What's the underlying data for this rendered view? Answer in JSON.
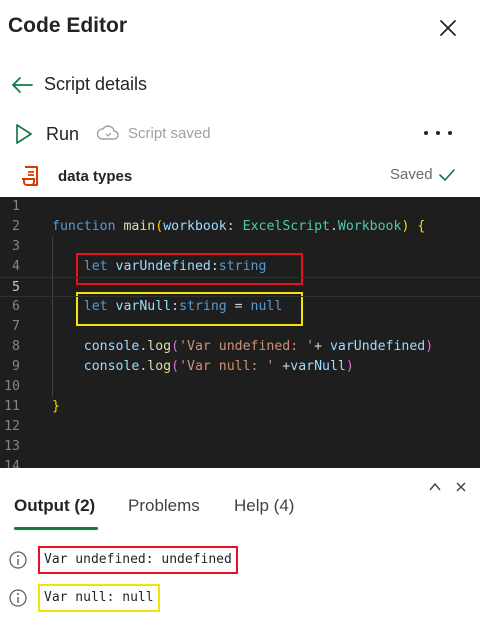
{
  "header": {
    "title": "Code Editor"
  },
  "nav": {
    "back_label": "Script details"
  },
  "toolbar": {
    "run_label": "Run",
    "status_label": "Script saved"
  },
  "file": {
    "name": "data types",
    "save_state": "Saved"
  },
  "editor": {
    "line_numbers": [
      "1",
      "2",
      "3",
      "4",
      "5",
      "6",
      "7",
      "8",
      "9",
      "10",
      "11",
      "12",
      "13",
      "14"
    ],
    "active_line": "5",
    "lines": [
      [],
      [
        {
          "t": "function",
          "c": "kw"
        },
        {
          "t": " "
        },
        {
          "t": "main",
          "c": "fn"
        },
        {
          "t": "(",
          "c": "p1"
        },
        {
          "t": "workbook",
          "c": "var"
        },
        {
          "t": ": "
        },
        {
          "t": "ExcelScript",
          "c": "type"
        },
        {
          "t": "."
        },
        {
          "t": "Workbook",
          "c": "type"
        },
        {
          "t": ")",
          "c": "p1"
        },
        {
          "t": " "
        },
        {
          "t": "{",
          "c": "p1"
        }
      ],
      [],
      [
        {
          "t": "    "
        },
        {
          "t": "let",
          "c": "kw"
        },
        {
          "t": " "
        },
        {
          "t": "varUndefined",
          "c": "var"
        },
        {
          "t": ":"
        },
        {
          "t": "string",
          "c": "kw"
        }
      ],
      [],
      [
        {
          "t": "    "
        },
        {
          "t": "let",
          "c": "kw"
        },
        {
          "t": " "
        },
        {
          "t": "varNull",
          "c": "var"
        },
        {
          "t": ":"
        },
        {
          "t": "string",
          "c": "kw"
        },
        {
          "t": " = "
        },
        {
          "t": "null",
          "c": "kw"
        }
      ],
      [],
      [
        {
          "t": "    "
        },
        {
          "t": "console",
          "c": "var"
        },
        {
          "t": "."
        },
        {
          "t": "log",
          "c": "fn"
        },
        {
          "t": "(",
          "c": "p2"
        },
        {
          "t": "'Var undefined: '",
          "c": "str"
        },
        {
          "t": "+ "
        },
        {
          "t": "varUndefined",
          "c": "var"
        },
        {
          "t": ")",
          "c": "p2"
        }
      ],
      [
        {
          "t": "    "
        },
        {
          "t": "console",
          "c": "var"
        },
        {
          "t": "."
        },
        {
          "t": "log",
          "c": "fn"
        },
        {
          "t": "(",
          "c": "p2"
        },
        {
          "t": "'Var null: '",
          "c": "str"
        },
        {
          "t": " +"
        },
        {
          "t": "varNull",
          "c": "var"
        },
        {
          "t": ")",
          "c": "p2"
        }
      ],
      [],
      [
        {
          "t": "}",
          "c": "p1"
        }
      ],
      [],
      [],
      []
    ]
  },
  "output_panel": {
    "tabs": [
      {
        "label": "Output (2)",
        "active": true
      },
      {
        "label": "Problems",
        "active": false
      },
      {
        "label": "Help (4)",
        "active": false
      }
    ],
    "messages": [
      "Var undefined: undefined",
      "Var null: null"
    ]
  },
  "colors": {
    "accent_green": "#107c41",
    "highlight_red": "#e81123",
    "highlight_yellow": "#f2e300",
    "editor_bg": "#1e1e1e"
  },
  "icons": {
    "close": "close-icon",
    "back": "back-arrow-icon",
    "run": "play-icon",
    "cloud": "cloud-sync-icon",
    "more": "more-icon",
    "file": "script-file-icon",
    "check": "checkmark-icon",
    "collapse": "chevron-up-icon",
    "panel_close": "close-icon",
    "info": "info-icon"
  }
}
